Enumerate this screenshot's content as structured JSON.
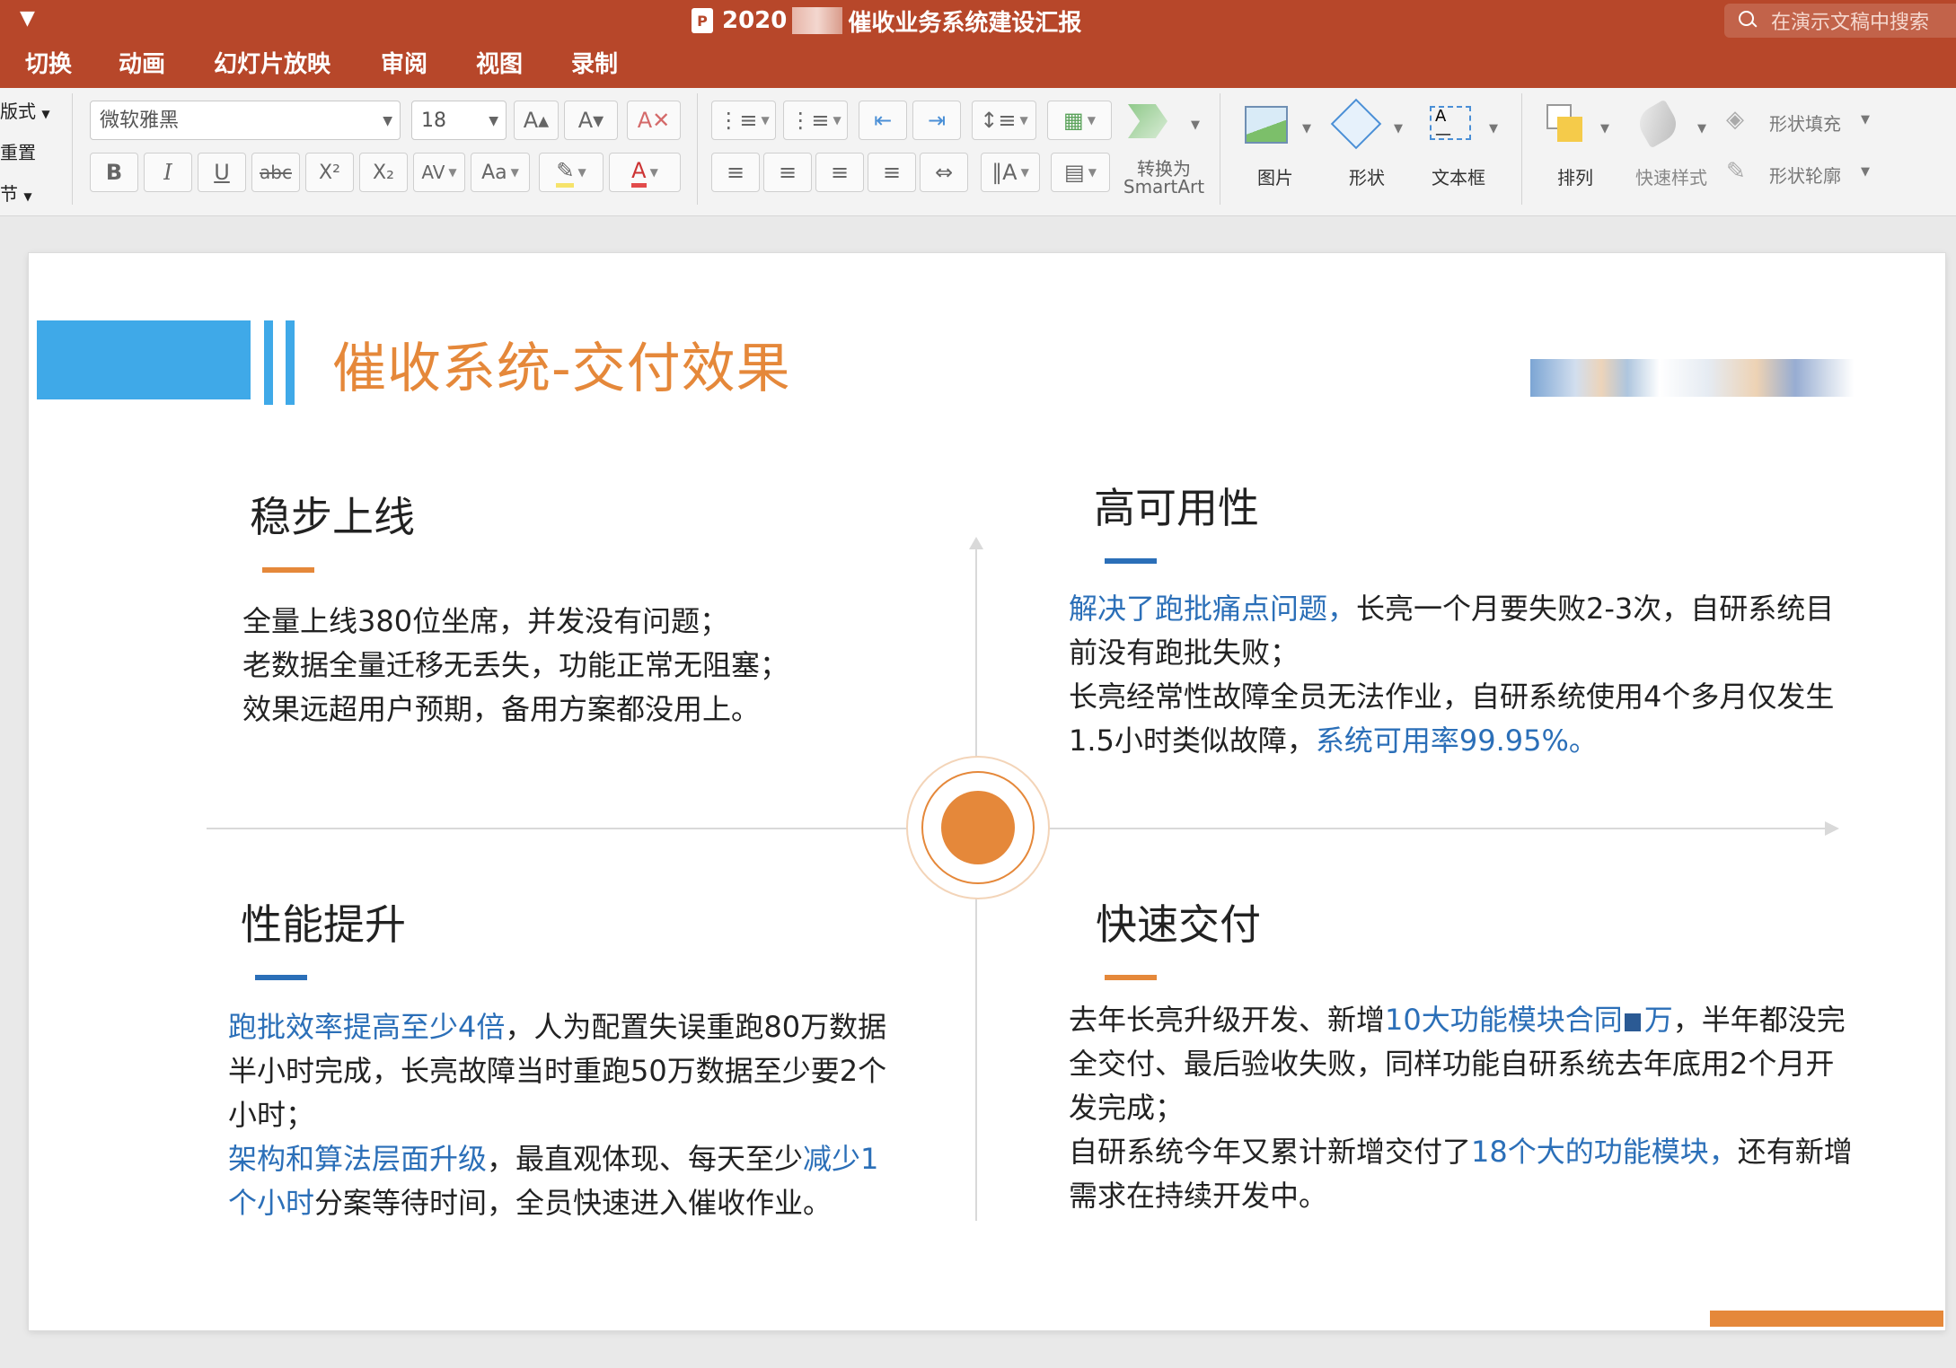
{
  "titlebar": {
    "title_prefix": "2020",
    "title_suffix": "催收业务系统建设汇报",
    "search_placeholder": "在演示文稿中搜索",
    "app_icon": "P"
  },
  "tabs": [
    "切换",
    "动画",
    "幻灯片放映",
    "审阅",
    "视图",
    "录制"
  ],
  "ribbon": {
    "left_items": [
      "版式",
      "重置",
      "节"
    ],
    "font_name": "微软雅黑",
    "font_size": "18",
    "convert_smartart_line1": "转换为",
    "convert_smartart_line2": "SmartArt",
    "picture_label": "图片",
    "shape_label": "形状",
    "textbox_label": "文本框",
    "arrange_label": "排列",
    "quick_style_label": "快速样式",
    "shape_fill_label": "形状填充",
    "shape_outline_label": "形状轮廓",
    "bold": "B",
    "italic": "I",
    "underline": "U",
    "strike": "abc",
    "superscript": "X²",
    "subscript": "X₂",
    "spacing": "AV",
    "case": "Aa"
  },
  "slide": {
    "title": "催收系统-交付效果",
    "q1": {
      "title": "稳步上线",
      "lines": [
        "全量上线380位坐席，并发没有问题；",
        "老数据全量迁移无丢失，功能正常无阻塞；",
        "效果远超用户预期，备用方案都没用上。"
      ]
    },
    "q2": {
      "title": "高可用性",
      "l1_hl": "解决了跑批痛点问题，",
      "l1_rest": "长亮一个月要失败2-3次，自研系统目",
      "l2": "前没有跑批失败；",
      "l3": "长亮经常性故障全员无法作业，自研系统使用4个多月仅发生",
      "l4_pre": "1.5小时类似故障，",
      "l4_hl": "系统可用率99.95%。"
    },
    "q3": {
      "title": "性能提升",
      "l1_hl": "跑批效率提高至少4倍",
      "l1_rest": "，人为配置失误重跑80万数据",
      "l2": "半小时完成，长亮故障当时重跑50万数据至少要2个",
      "l3": "小时；",
      "l4_hl": "架构和算法层面升级",
      "l4_mid": "，最直观体现、每天至少",
      "l4_hl2": "减少1",
      "l5_hl": "个小时",
      "l5_rest": "分案等待时间，全员快速进入催收作业。"
    },
    "q4": {
      "title": "快速交付",
      "l1_pre": "去年长亮升级开发、新增",
      "l1_hl": "10大功能模块合同",
      "l1_hl2": "万",
      "l1_rest": "，半年都没完",
      "l2": "全交付、最后验收失败，同样功能自研系统去年底用2个月开",
      "l3": "发完成；",
      "l4_pre": "自研系统今年又累计新增交付了",
      "l4_hl": "18个大的功能模块，",
      "l4_rest": "还有新增",
      "l5": "需求在持续开发中。"
    }
  },
  "colors": {
    "titlebar": "#b7472a",
    "accent_orange": "#e5883a",
    "accent_blue": "#3fa9e8",
    "text_highlight_blue": "#2b6fb8",
    "underline_blue": "#2b6fb8"
  }
}
